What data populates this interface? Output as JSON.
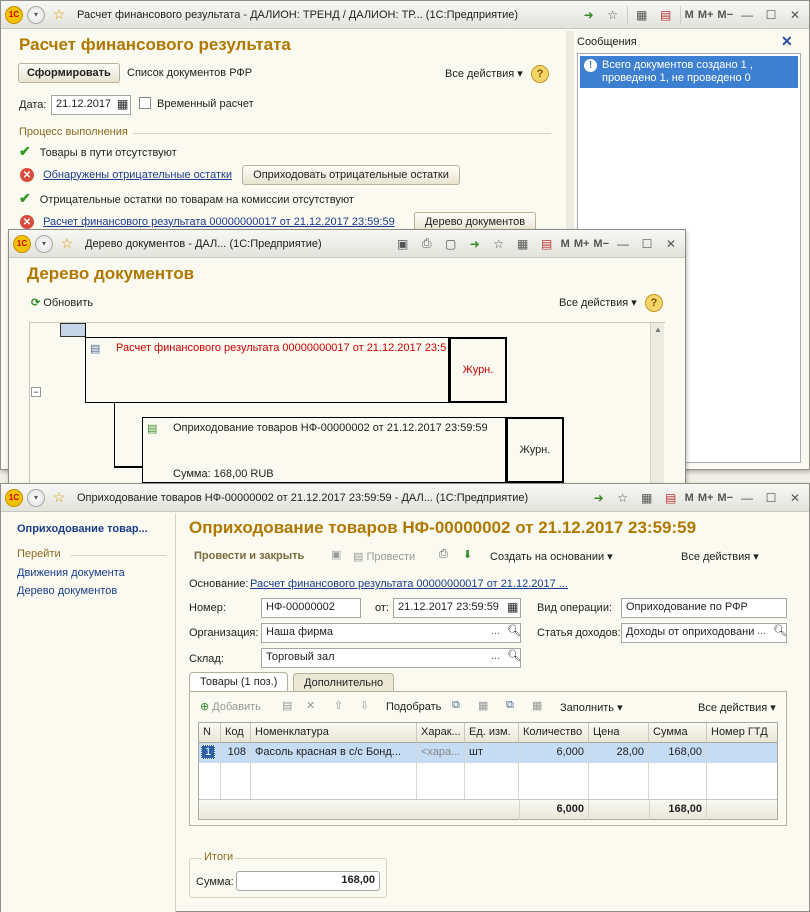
{
  "win1": {
    "title": "Расчет финансового результата - ДАЛИОН: ТРЕНД / ДАЛИОН: ТР...",
    "app": "(1С:Предприятие)",
    "form_title": "Расчет финансового результата",
    "generate_button": "Сформировать",
    "doc_list_link": "Список документов РФР",
    "all_actions": "Все действия",
    "date_label": "Дата:",
    "date_value": "21.12.2017",
    "temp_calc_label": "Временный расчет",
    "process_group": "Процесс выполнения",
    "steps": [
      {
        "text": "Товары в пути отсутствуют",
        "status": "ok"
      },
      {
        "text": "Обнаружены отрицательные остатки",
        "status": "error",
        "button": "Оприходовать отрицательные остатки"
      },
      {
        "text": "Отрицательные остатки по товарам на комиссии отсутствуют",
        "status": "ok"
      },
      {
        "text": "Расчет финансового результата 00000000017 от 21.12.2017 23:59:59",
        "status": "error",
        "button": "Дерево документов"
      }
    ],
    "messages_title": "Сообщения",
    "message_text": "Всего документов создано 1 , проведено 1, не проведено 0"
  },
  "win2": {
    "title": "Дерево документов - ДАЛ...",
    "app": "(1С:Предприятие)",
    "form_title": "Дерево документов",
    "refresh": "Обновить",
    "all_actions": "Все действия",
    "node1": {
      "text": "Расчет финансового результата 00000000017 от 21.12.2017 23:5",
      "journal": "Журн."
    },
    "node2": {
      "text": "Оприходование товаров НФ-00000002 от 21.12.2017 23:59:59",
      "sum": "Сумма: 168,00 RUB",
      "journal": "Журн."
    }
  },
  "win3": {
    "title": "Оприходование товаров НФ-00000002 от 21.12.2017 23:59:59 - ДАЛ...",
    "app": "(1С:Предприятие)",
    "nav_current": "Оприходование товар...",
    "nav_group": "Перейти",
    "nav_items": [
      "Движения документа",
      "Дерево документов"
    ],
    "form_title": "Оприходование товаров НФ-00000002 от 21.12.2017 23:59:59",
    "post_close": "Провести и закрыть",
    "post": "Провести",
    "create_based": "Создать на основании",
    "all_actions": "Все действия",
    "basis_label": "Основание:",
    "basis_value": "Расчет финансового результата 00000000017 от 21.12.2017 ...",
    "number_label": "Номер:",
    "number_value": "НФ-00000002",
    "from_label": "от:",
    "from_value": "21.12.2017 23:59:59",
    "op_label": "Вид операции:",
    "op_value": "Оприходование по РФР",
    "org_label": "Организация:",
    "org_value": "Наша фирма",
    "income_label": "Статья доходов:",
    "income_value": "Доходы от оприходовани",
    "warehouse_label": "Склад:",
    "warehouse_value": "Торговый зал",
    "tabs": [
      "Товары (1 поз.)",
      "Дополнительно"
    ],
    "toolbar": {
      "add": "Добавить",
      "select": "Подобрать",
      "fill": "Заполнить",
      "all_actions": "Все действия"
    },
    "columns": [
      "N",
      "Код",
      "Номенклатура",
      "Харак...",
      "Ед. изм.",
      "Количество",
      "Цена",
      "Сумма",
      "Номер ГТД"
    ],
    "rows": [
      {
        "n": "1",
        "code": "108",
        "name": "Фасоль красная в с/с Бонд...",
        "char": "<хара...",
        "unit": "шт",
        "qty": "6,000",
        "price": "28,00",
        "sum": "168,00",
        "gtd": ""
      }
    ],
    "totals": {
      "qty": "6,000",
      "sum": "168,00"
    },
    "totals_group": "Итоги",
    "total_sum_label": "Сумма:",
    "total_sum_value": "168,00"
  }
}
